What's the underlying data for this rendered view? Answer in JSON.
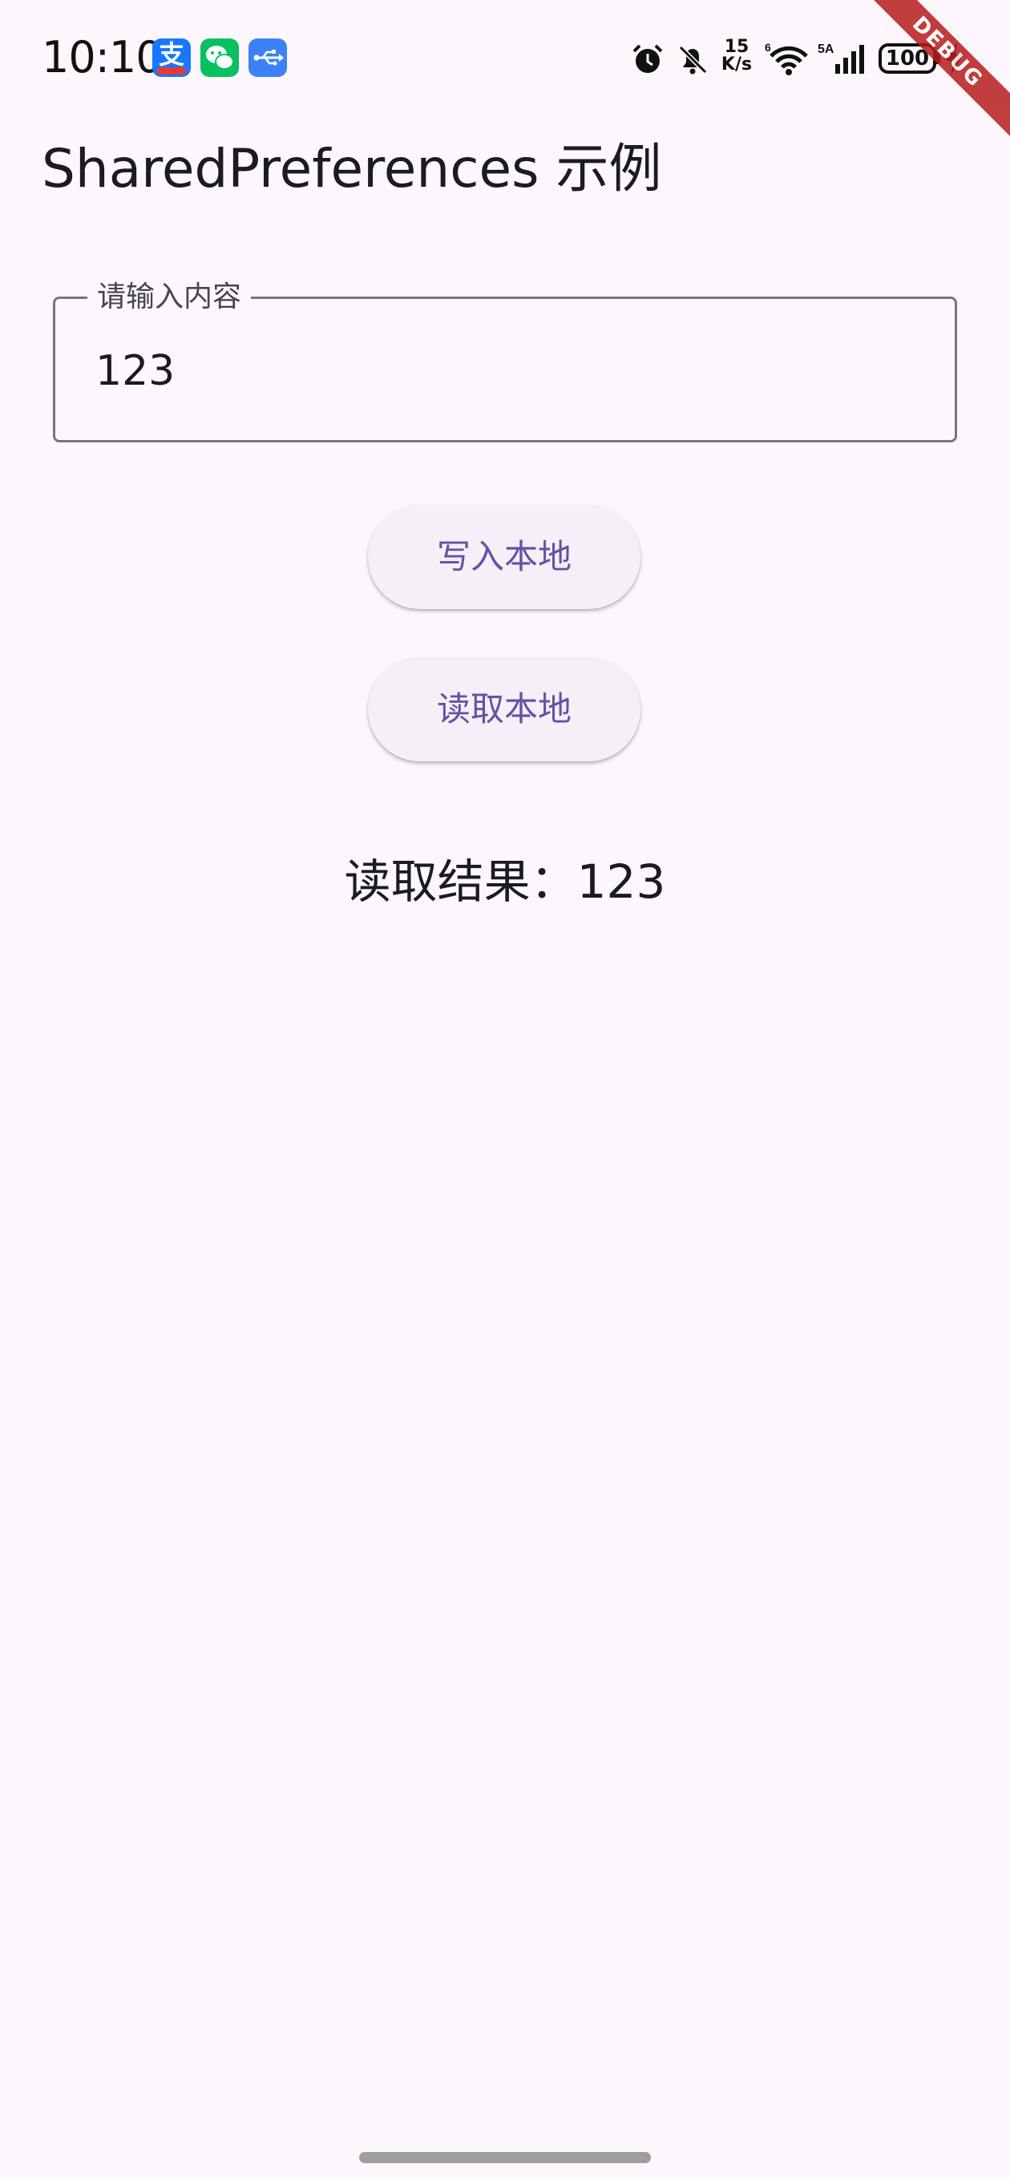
{
  "status_bar": {
    "time": "10:10",
    "notification_icons": [
      "alipay-app-icon",
      "wechat-app-icon",
      "usb-icon"
    ],
    "network_speed": "15\nK/s",
    "battery": "100",
    "system_icons": [
      "alarm-icon",
      "mute-icon",
      "wifi-icon",
      "signal-icon",
      "charging-icon"
    ]
  },
  "debug_banner": "DEBUG",
  "app_bar": {
    "title": "SharedPreferences 示例"
  },
  "input": {
    "label": "请输入内容",
    "value": "123"
  },
  "buttons": {
    "write": "写入本地",
    "read": "读取本地"
  },
  "result": {
    "text": "读取结果：123"
  },
  "colors": {
    "background": "#fdf7fd",
    "button_bg": "#f6eff8",
    "button_text": "#6750a4",
    "outline": "#79747e",
    "debug_ribbon": "#b71c1c"
  }
}
